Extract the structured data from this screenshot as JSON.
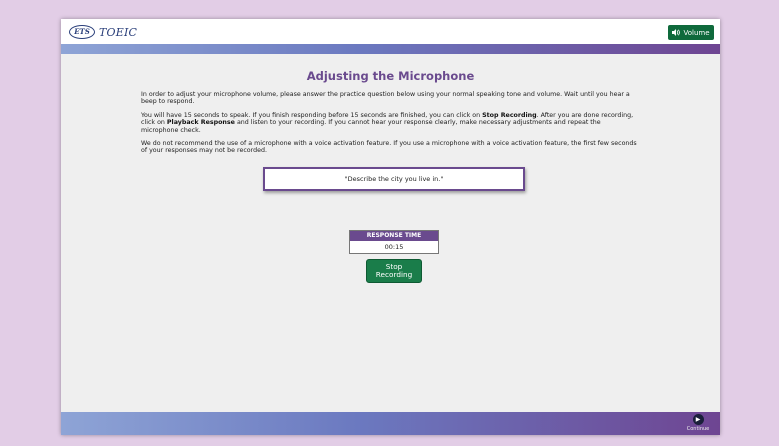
{
  "header": {
    "logo_mark": "ETS",
    "logo_text": "TOEIC",
    "volume_label": "Volume"
  },
  "main": {
    "title": "Adjusting the Microphone",
    "paragraph1": "In order to adjust your microphone volume, please answer the practice question below using your normal speaking tone and volume. Wait until you hear a beep to respond.",
    "p2_before": "You will have 15 seconds to speak. If you finish responding before 15 seconds are finished, you can click on ",
    "p2_bold1": "Stop Recording",
    "p2_mid": ". After you are done recording, click on ",
    "p2_bold2": "Playback Response",
    "p2_after": " and listen to your recording. If you cannot hear your response clearly, make necessary adjustments and repeat the microphone check.",
    "paragraph3": "We do not recommend the use of a microphone with a voice activation feature. If you use a microphone with a voice activation feature, the first few seconds of your responses may not be recorded.",
    "prompt": "\"Describe the city you live in.\"",
    "response_time_label": "RESPONSE TIME",
    "response_time_value": "00:15",
    "stop_label_line1": "Stop",
    "stop_label_line2": "Recording"
  },
  "footer": {
    "continue_label": "Continue"
  },
  "colors": {
    "accent_purple": "#6a4a8e",
    "button_green": "#1a7d4a",
    "background_lilac": "#e2cde6"
  }
}
